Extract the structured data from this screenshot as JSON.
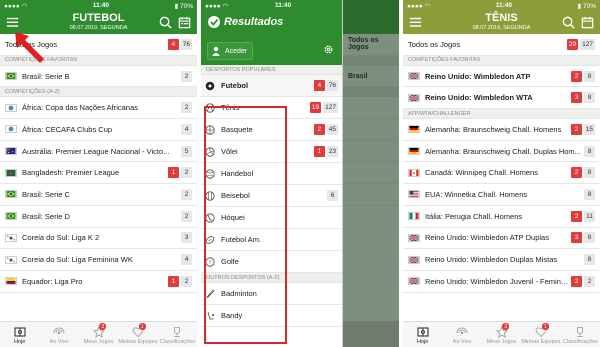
{
  "status": {
    "time": "11:40",
    "battery": "70%"
  },
  "screen1": {
    "title": "FUTEBOL",
    "date": "08.07.2019, SEGUNDA",
    "top_label": "Todos os Jogos",
    "top_badges": [
      "4",
      "76"
    ],
    "fav_header": "COMPETIÇÕES FAVORITAS",
    "fav_item": {
      "label": "Brasil: Serie B",
      "badge": "2"
    },
    "az_header": "COMPETIÇÕES (A-Z)",
    "items": [
      {
        "label": "África: Copa das Nações Africanas",
        "badges": [
          {
            "v": "2",
            "red": false
          }
        ]
      },
      {
        "label": "África: CECAFA Clubs Cup",
        "badges": [
          {
            "v": "4",
            "red": false
          }
        ]
      },
      {
        "label": "Austrália: Premier League Nacional - Victo...",
        "badges": [
          {
            "v": "5",
            "red": false
          }
        ]
      },
      {
        "label": "Bangladesh: Premier League",
        "badges": [
          {
            "v": "1",
            "red": true
          },
          {
            "v": "2",
            "red": false
          }
        ]
      },
      {
        "label": "Brasil: Serie C",
        "badges": [
          {
            "v": "2",
            "red": false
          }
        ]
      },
      {
        "label": "Brasil: Serie D",
        "badges": [
          {
            "v": "2",
            "red": false
          }
        ]
      },
      {
        "label": "Coreia do Sul: Liga K 2",
        "badges": [
          {
            "v": "3",
            "red": false
          }
        ]
      },
      {
        "label": "Coreia do Sul: Liga Feminina WK",
        "badges": [
          {
            "v": "4",
            "red": false
          }
        ]
      },
      {
        "label": "Equador: Liga Pro",
        "badges": [
          {
            "v": "1",
            "red": true
          },
          {
            "v": "2",
            "red": false
          }
        ]
      }
    ]
  },
  "tabs": [
    {
      "label": "Hoje",
      "icon": "field-icon",
      "badge": ""
    },
    {
      "label": "Ao Vivo",
      "icon": "live-icon",
      "badge": ""
    },
    {
      "label": "Meus Jogos",
      "icon": "star-icon",
      "badge": "3"
    },
    {
      "label": "Minhas Equipes",
      "icon": "heart-icon",
      "badge": "1"
    },
    {
      "label": "Classificações",
      "icon": "trophy-icon",
      "badge": ""
    }
  ],
  "screen2": {
    "logo": "Resultados",
    "login": "Aceder",
    "popular_header": "DESPORTOS POPULARES",
    "football": {
      "label": "Futebol",
      "badges": [
        "4",
        "76"
      ]
    },
    "sports": [
      {
        "label": "Tênis",
        "badges": [
          {
            "v": "19",
            "red": true
          },
          {
            "v": "127",
            "red": false
          }
        ]
      },
      {
        "label": "Basquete",
        "badges": [
          {
            "v": "2",
            "red": true
          },
          {
            "v": "45",
            "red": false
          }
        ]
      },
      {
        "label": "Vôlei",
        "badges": [
          {
            "v": "1",
            "red": true
          },
          {
            "v": "23",
            "red": false
          }
        ]
      },
      {
        "label": "Handebol",
        "badges": []
      },
      {
        "label": "Beisebol",
        "badges": [
          {
            "v": "6",
            "red": false
          }
        ]
      },
      {
        "label": "Hóquei",
        "badges": []
      },
      {
        "label": "Futebol Am.",
        "badges": []
      },
      {
        "label": "Golfe",
        "badges": []
      }
    ],
    "other_header": "OUTROS DESPORTOS (A-Z)",
    "other": [
      "Badminton",
      "Bandy"
    ],
    "behind": {
      "row1": "Todos os Jogos",
      "row2": "Brasil"
    }
  },
  "screen3": {
    "title": "TÊNIS",
    "date": "08.07.2019, SEGUNDA",
    "top_label": "Todos os Jogos",
    "top_badges": [
      "20",
      "127"
    ],
    "fav_header": "COMPETIÇÕES FAVORITAS",
    "favs": [
      {
        "label": "Reino Unido: Wimbledon ATP",
        "badges": [
          {
            "v": "2",
            "red": true
          },
          {
            "v": "8",
            "red": false
          }
        ]
      },
      {
        "label": "Reino Unido: Wimbledon WTA",
        "badges": [
          {
            "v": "3",
            "red": true
          },
          {
            "v": "8",
            "red": false
          }
        ]
      }
    ],
    "sect2": "ATP/WTA/CHALLENGER",
    "items": [
      {
        "label": "Alemanha: Braunschweig Chall. Homens",
        "flag": "de",
        "badges": [
          {
            "v": "2",
            "red": true
          },
          {
            "v": "15",
            "red": false
          }
        ]
      },
      {
        "label": "Alemanha: Braunschweig Chall. Duplas Hom...",
        "flag": "de",
        "badges": [
          {
            "v": "8",
            "red": false
          }
        ]
      },
      {
        "label": "Canadá: Winnipeg Chall. Homens",
        "flag": "ca",
        "badges": [
          {
            "v": "2",
            "red": true
          },
          {
            "v": "8",
            "red": false
          }
        ]
      },
      {
        "label": "EUA: Winnetka Chall. Homens",
        "flag": "us",
        "badges": [
          {
            "v": "8",
            "red": false
          }
        ]
      },
      {
        "label": "Itália: Perugia Chall. Homens",
        "flag": "it",
        "badges": [
          {
            "v": "2",
            "red": true
          },
          {
            "v": "11",
            "red": false
          }
        ]
      },
      {
        "label": "Reino Unido: Wimbledon ATP Duplas",
        "flag": "uk",
        "badges": [
          {
            "v": "3",
            "red": true
          },
          {
            "v": "8",
            "red": false
          }
        ]
      },
      {
        "label": "Reino Unido: Wimbledon Duplas Mistas",
        "flag": "uk",
        "badges": [
          {
            "v": "8",
            "red": false
          }
        ]
      },
      {
        "label": "Reino Unido: Wimbledon Juvenil - Feminin...",
        "flag": "uk",
        "badges": [
          {
            "v": "2",
            "red": true
          },
          {
            "v": "2",
            "red": false
          }
        ]
      }
    ]
  },
  "colors": {
    "green": "#2e8b2e",
    "olive": "#8b9e3a",
    "red": "#e23b3b",
    "highlight": "#d62a2a"
  }
}
